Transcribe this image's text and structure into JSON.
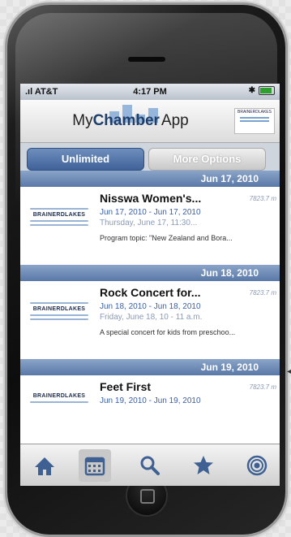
{
  "status_bar": {
    "carrier": ".ıl AT&T",
    "time": "4:17 PM"
  },
  "header": {
    "title_prefix": "My",
    "title_bold": "Chamber",
    "title_suffix": "App",
    "partner_logo_text": "BRAINERDLAKES"
  },
  "tabs": {
    "unlimited": "Unlimited",
    "more_options": "More Options"
  },
  "sections": [
    {
      "date": "Jun 17, 2010",
      "event": {
        "logo": "BRAINERDLAKES",
        "title": "Nisswa Women's...",
        "distance": "7823.7 m",
        "dates": "Jun 17, 2010 - Jun 17, 2010",
        "when": "Thursday, June 17, 11:30...",
        "description": "Program topic: \"New Zealand and Bora..."
      }
    },
    {
      "date": "Jun 18, 2010",
      "event": {
        "logo": "BRAINERDLAKES",
        "title": "Rock Concert for...",
        "distance": "7823.7 m",
        "dates": "Jun 18, 2010 - Jun 18, 2010",
        "when": "Friday, June 18, 10 - 11 a.m.",
        "description": "A special concert for kids from preschoo..."
      }
    },
    {
      "date": "Jun 19, 2010",
      "event": {
        "logo": "BRAINERDLAKES",
        "title": "Feet First",
        "distance": "7823.7 m",
        "dates": "Jun 19, 2010 - Jun 19, 2010"
      }
    }
  ],
  "tab_bar": {
    "icons": [
      "home-icon",
      "calendar-icon",
      "search-icon",
      "star-icon",
      "target-icon"
    ],
    "active_index": 1
  },
  "colors": {
    "accent": "#3f6299",
    "date_header": "#5a79a8",
    "link_text": "#3a5fa8"
  }
}
